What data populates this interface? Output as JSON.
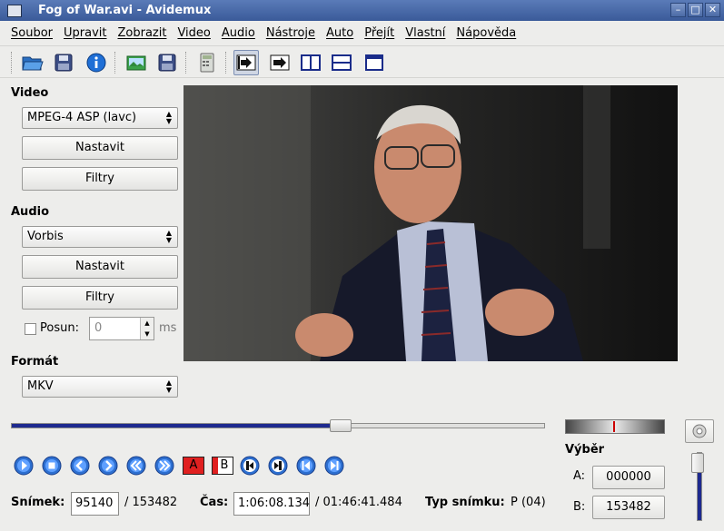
{
  "window": {
    "title": "Fog of War.avi - Avidemux"
  },
  "menu": [
    "Soubor",
    "Upravit",
    "Zobrazit",
    "Video",
    "Audio",
    "Nástroje",
    "Auto",
    "Přejít",
    "Vlastní",
    "Nápověda"
  ],
  "video": {
    "section_label": "Video",
    "codec": "MPEG-4 ASP (lavc)",
    "configure_label": "Nastavit",
    "filters_label": "Filtry"
  },
  "audio": {
    "section_label": "Audio",
    "codec": "Vorbis",
    "configure_label": "Nastavit",
    "filters_label": "Filtry",
    "shift_label": "Posun:",
    "shift_value": "0",
    "shift_unit": "ms",
    "shift_enabled": false
  },
  "format": {
    "section_label": "Formát",
    "container": "MKV"
  },
  "playback": {
    "position_fraction": 0.62
  },
  "selection": {
    "label": "Výběr",
    "a_label": "A:",
    "a_value": "000000",
    "b_label": "B:",
    "b_value": "153482"
  },
  "status": {
    "frame_label": "Snímek:",
    "frame_value": "95140",
    "frame_total": "/ 153482",
    "time_label": "Čas:",
    "time_value": "1:06:08.134",
    "time_total": "/ 01:46:41.484",
    "frame_type_label": "Typ snímku:",
    "frame_type_value": "P (04)"
  },
  "markers": {
    "a": "A",
    "b": "B"
  },
  "colors": {
    "accent": "#1e2a8f",
    "title_bar": "#4a6aa8",
    "marker_a": "#e02020"
  }
}
